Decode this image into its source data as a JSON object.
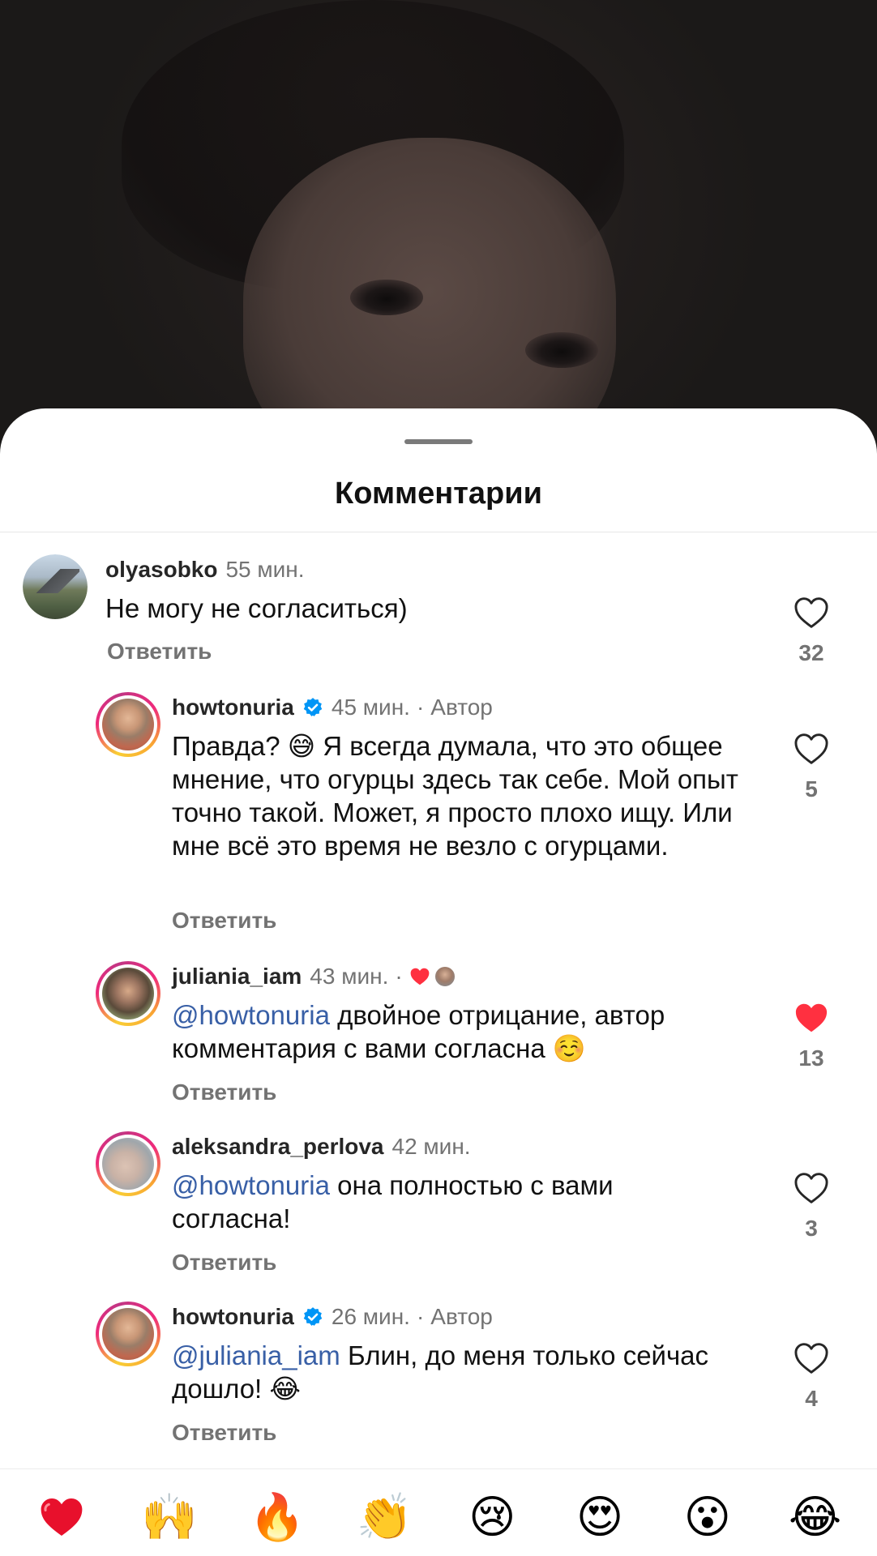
{
  "sheet": {
    "title": "Комментарии"
  },
  "comments": [
    {
      "username": "olyasobko",
      "time": "55 мин.",
      "text": "Не могу не согласиться)",
      "reply_label": "Ответить",
      "likes": "32",
      "liked": false
    },
    {
      "username": "howtonuria",
      "verified": true,
      "time": "45 мин.",
      "author_label": "Автор",
      "text_line1": "Правда?",
      "emoji": "😅",
      "text_rest": "Я всегда думала, что это общее мнение, что огурцы здесь так себе. Мой опыт точно такой. Может, я просто плохо ищу. Или мне всё это время не везло с огурцами.",
      "reply_label": "Ответить",
      "likes": "5",
      "liked": false
    },
    {
      "username": "juliania_iam",
      "time": "43 мин.",
      "mention": "@howtonuria",
      "text": "двойное отрицание, автор комментария с вами согласна",
      "emoji": "☺️",
      "reply_label": "Ответить",
      "likes": "13",
      "liked": true
    },
    {
      "username": "aleksandra_perlova",
      "time": "42 мин.",
      "mention": "@howtonuria",
      "text": "она полностью с вами согласна!",
      "reply_label": "Ответить",
      "likes": "3",
      "liked": false
    },
    {
      "username": "howtonuria",
      "verified": true,
      "time": "26 мин.",
      "author_label": "Автор",
      "mention": "@juliania_iam",
      "text": "Блин, до меня только сейчас дошло!",
      "emoji": "😂",
      "reply_label": "Ответить",
      "likes": "4",
      "liked": false
    }
  ],
  "reactions": [
    "❤️",
    "🙌",
    "🔥",
    "👏",
    "😢",
    "😍",
    "😮",
    "😂"
  ],
  "colors": {
    "like_red": "#ff3040",
    "mention_blue": "#385fa6",
    "verified_blue": "#0095f6",
    "muted": "#737373"
  }
}
